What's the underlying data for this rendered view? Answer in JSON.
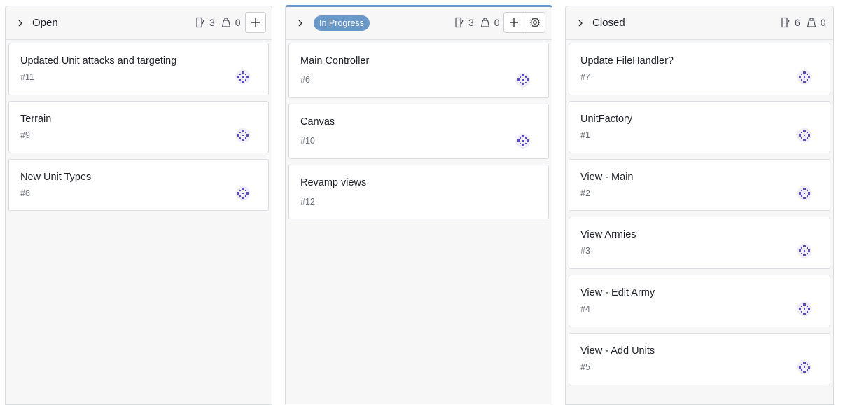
{
  "columns": [
    {
      "title": "Open",
      "issue_count": "3",
      "mr_count": "0",
      "add_label": "+",
      "cards": [
        {
          "title": "Updated Unit attacks and targeting",
          "number": "#11"
        },
        {
          "title": "Terrain",
          "number": "#9"
        },
        {
          "title": "New Unit Types",
          "number": "#8"
        }
      ]
    },
    {
      "title": "In Progress",
      "issue_count": "3",
      "mr_count": "0",
      "cards": [
        {
          "title": "Main Controller",
          "number": "#6"
        },
        {
          "title": "Canvas",
          "number": "#10"
        },
        {
          "title": "Revamp views",
          "number": "#12"
        }
      ]
    },
    {
      "title": "Closed",
      "issue_count": "6",
      "mr_count": "0",
      "cards": [
        {
          "title": "Update FileHandler?",
          "number": "#7"
        },
        {
          "title": "UnitFactory",
          "number": "#1"
        },
        {
          "title": "View - Main",
          "number": "#2"
        },
        {
          "title": "View Armies",
          "number": "#3"
        },
        {
          "title": "View - Edit Army",
          "number": "#4"
        },
        {
          "title": "View - Add Units",
          "number": "#5"
        }
      ]
    }
  ],
  "colors": {
    "accent": "#6a98c8",
    "avatar": "#5b4bc4"
  },
  "icons": {
    "collapse": "chevron-right-icon",
    "issues": "issue-icon",
    "weight": "weight-icon",
    "add": "plus-icon",
    "settings": "gear-icon"
  }
}
